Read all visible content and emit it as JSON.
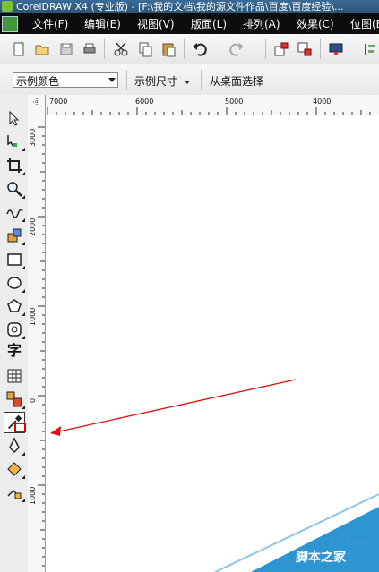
{
  "window": {
    "title": "CorelDRAW X4 (专业版) - [F:\\我的文档\\我的源文件作品\\百度\\百度经验\\..."
  },
  "menu": [
    "文件(F)",
    "编辑(E)",
    "视图(V)",
    "版面(L)",
    "排列(A)",
    "效果(C)",
    "位图(B)"
  ],
  "standard_toolbar": {
    "icons": [
      "new-icon",
      "open-icon",
      "save-icon",
      "print-icon",
      "cut-icon",
      "copy-icon",
      "paste-icon",
      "undo-icon",
      "redo-icon",
      "import-icon",
      "export-icon",
      "application-launcher-icon",
      "align-icon"
    ]
  },
  "property_bar": {
    "color_select_value": "示例颜色",
    "size_label": "示例尺寸",
    "desktop_label": "从桌面选择"
  },
  "toolbox": {
    "tools": [
      "pick-tool-icon",
      "shape-tool-icon",
      "crop-tool-icon",
      "zoom-tool-icon",
      "freehand-tool-icon",
      "smart-fill-tool-icon",
      "rectangle-tool-icon",
      "ellipse-tool-icon",
      "polygon-tool-icon",
      "basic-shapes-tool-icon",
      "text-tool-icon",
      "table-tool-icon",
      "interactive-blend-tool-icon",
      "eyedropper-tool-icon",
      "outline-tool-icon",
      "fill-tool-icon",
      "interactive-fill-tool-icon"
    ],
    "text_tool_glyph": "字",
    "highlight_color": "#e00000"
  },
  "rulers": {
    "horizontal_labels": [
      "7000",
      "6000",
      "5000",
      "4000"
    ],
    "vertical_labels": [
      "3000",
      "2000",
      "1000",
      "0",
      "1000"
    ]
  },
  "annotation": {
    "arrow_color": "#e01010"
  },
  "watermark": {
    "site": "jb51.net",
    "name": "脚本之家"
  }
}
